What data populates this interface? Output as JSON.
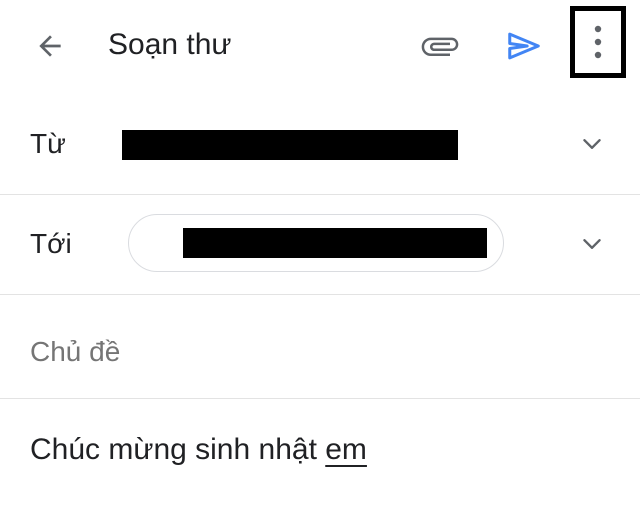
{
  "app_bar": {
    "title": "Soạn thư",
    "icons": {
      "back": "arrow-back-icon",
      "attach": "paperclip-icon",
      "send": "send-icon",
      "more": "more-vert-icon"
    },
    "colors": {
      "send_icon": "#4285f4",
      "icon": "#5f6368"
    }
  },
  "from": {
    "label": "Từ"
  },
  "to": {
    "label": "Tới"
  },
  "subject": {
    "placeholder": "Chủ đề",
    "value": ""
  },
  "body": {
    "text_prefix": "Chúc mừng sinh nhật ",
    "text_underlined": "em"
  }
}
